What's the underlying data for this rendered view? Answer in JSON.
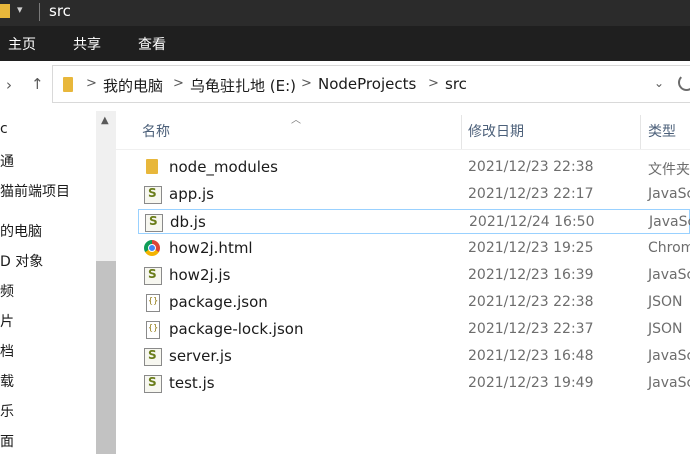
{
  "window": {
    "title": "src"
  },
  "ribbon": {
    "tabs": [
      "主页",
      "共享",
      "查看"
    ]
  },
  "address": {
    "crumbs": [
      "我的电脑",
      "乌龟驻扎地 (E:)",
      "NodeProjects",
      "src"
    ],
    "separator": ">"
  },
  "nav": {
    "items": [
      "c",
      "通",
      "猫前端项目",
      "的电脑",
      "D 对象",
      "频",
      "片",
      "档",
      "载",
      "乐",
      "面"
    ]
  },
  "columns": {
    "name": "名称",
    "date": "修改日期",
    "type": "类型"
  },
  "files": [
    {
      "name": "node_modules",
      "date": "2021/12/23 22:38",
      "type": "文件夹",
      "icon": "folder-icon"
    },
    {
      "name": "app.js",
      "date": "2021/12/23 22:17",
      "type": "JavaSc",
      "icon": "js-file-icon"
    },
    {
      "name": "db.js",
      "date": "2021/12/24 16:50",
      "type": "JavaSc",
      "icon": "js-file-icon",
      "selected": true
    },
    {
      "name": "how2j.html",
      "date": "2021/12/23 19:25",
      "type": "Chrom",
      "icon": "chrome-icon"
    },
    {
      "name": "how2j.js",
      "date": "2021/12/23 16:39",
      "type": "JavaSc",
      "icon": "js-file-icon"
    },
    {
      "name": "package.json",
      "date": "2021/12/23 22:38",
      "type": "JSON",
      "icon": "json-file-icon"
    },
    {
      "name": "package-lock.json",
      "date": "2021/12/23 22:37",
      "type": "JSON",
      "icon": "json-file-icon"
    },
    {
      "name": "server.js",
      "date": "2021/12/23 16:48",
      "type": "JavaSc",
      "icon": "js-file-icon"
    },
    {
      "name": "test.js",
      "date": "2021/12/23 19:49",
      "type": "JavaSc",
      "icon": "js-file-icon"
    }
  ],
  "colors": {
    "titlebar": "#2b2b2b",
    "ribbon": "#1f1f1f",
    "folder": "#e8b73b",
    "selection_border": "#99d1ff"
  }
}
